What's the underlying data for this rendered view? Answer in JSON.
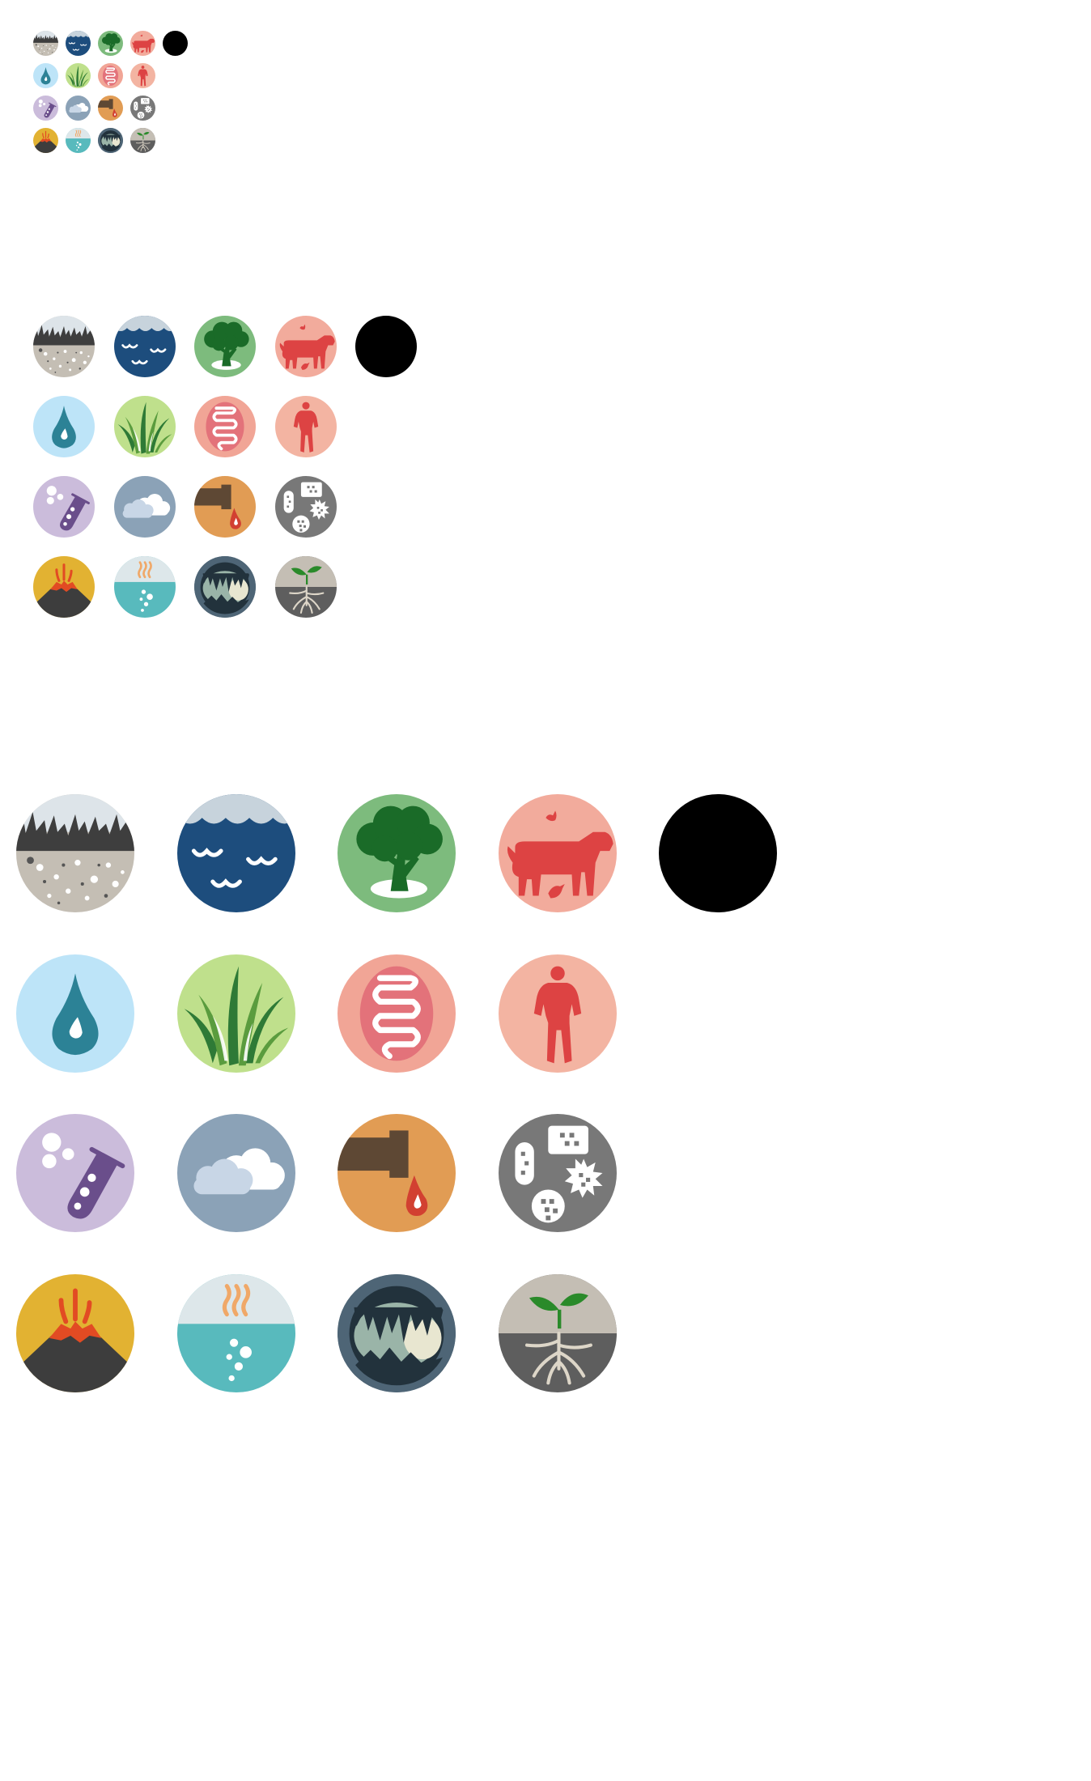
{
  "sheet": {
    "title": "",
    "icon_order": [
      "soil",
      "ocean",
      "forest",
      "animal",
      "dark",
      "freshwater",
      "grassland",
      "gut",
      "human",
      "lab",
      "air",
      "wastewater",
      "microbes",
      "volcano",
      "hotspring",
      "cave",
      "rhizosphere"
    ],
    "icons": [
      {
        "id": "soil",
        "name": "soil-icon",
        "colors": {
          "bg": "#c4beb4",
          "sky": "#dde4e9",
          "grass": "#3e3e3e"
        }
      },
      {
        "id": "ocean",
        "name": "ocean-waves-icon",
        "colors": {
          "bg": "#1d4d7d",
          "foam": "#c7d3dc"
        }
      },
      {
        "id": "forest",
        "name": "tree-forest-icon",
        "colors": {
          "bg": "#7dbb7d",
          "tree": "#1a6b28"
        }
      },
      {
        "id": "animal",
        "name": "cow-animal-icon",
        "colors": {
          "bg": "#f2ab9c",
          "shape": "#dd4343"
        }
      },
      {
        "id": "dark",
        "name": "blank-black-icon",
        "colors": {
          "bg": "#000000"
        }
      },
      {
        "id": "freshwater",
        "name": "water-drop-icon",
        "colors": {
          "bg": "#bde4f8",
          "drop": "#2c8296"
        }
      },
      {
        "id": "grassland",
        "name": "grass-icon",
        "colors": {
          "bg": "#bfe08c",
          "dark": "#2e7a36",
          "light": "#5a9c3e"
        }
      },
      {
        "id": "gut",
        "name": "intestine-gut-icon",
        "colors": {
          "bg": "#f1a596",
          "inner": "#e3727a"
        }
      },
      {
        "id": "human",
        "name": "human-figure-icon",
        "colors": {
          "bg": "#f3b4a2",
          "shape": "#dd4343"
        }
      },
      {
        "id": "lab",
        "name": "test-tube-lab-icon",
        "colors": {
          "bg": "#cbbcdb",
          "tube": "#6a4e8b"
        }
      },
      {
        "id": "air",
        "name": "cloud-air-icon",
        "colors": {
          "bg": "#8ba2b7",
          "cloud": "#c8d6e6"
        }
      },
      {
        "id": "wastewater",
        "name": "pipe-wastewater-icon",
        "colors": {
          "bg": "#e19c54",
          "pipe": "#5e4834",
          "drop": "#d24031"
        }
      },
      {
        "id": "microbes",
        "name": "microbes-icon",
        "colors": {
          "bg": "#787878"
        }
      },
      {
        "id": "volcano",
        "name": "volcano-icon",
        "colors": {
          "bg": "#e2b232",
          "mountain": "#3d3d3d",
          "lava": "#e24b23"
        }
      },
      {
        "id": "hotspring",
        "name": "hot-spring-icon",
        "colors": {
          "bg": "#58babd",
          "sky": "#dde7ea",
          "steam": "#f0a868"
        }
      },
      {
        "id": "cave",
        "name": "cave-icon",
        "colors": {
          "bg": "#4e6576",
          "inner": "#9ab4a8"
        }
      },
      {
        "id": "rhizosphere",
        "name": "plant-roots-icon",
        "colors": {
          "bg": "#5e5e5e",
          "sky": "#c4beb4",
          "leaf": "#2a8a2a"
        }
      }
    ]
  }
}
